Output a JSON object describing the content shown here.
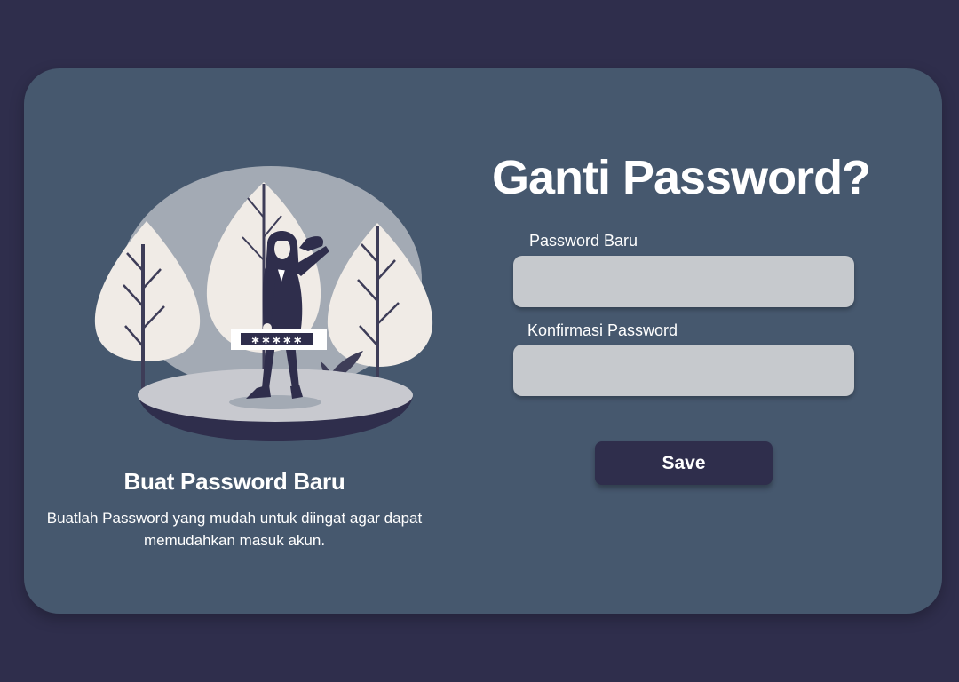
{
  "left_panel": {
    "title": "Buat Password Baru",
    "description": "Buatlah Password yang mudah untuk diingat agar dapat memudahkan masuk akun.",
    "illustration": {
      "password_mask": "∗∗∗∗∗",
      "icon": "woman-password-illustration"
    }
  },
  "form": {
    "title": "Ganti Password?",
    "new_password_label": "Password Baru",
    "new_password_value": "",
    "confirm_password_label": "Konfirmasi Password",
    "confirm_password_value": "",
    "save_label": "Save"
  },
  "colors": {
    "background": "#2f2e4c",
    "card": "#46586e",
    "input": "#c6c9cd",
    "button": "#2f2e4c",
    "text": "#ffffff"
  }
}
